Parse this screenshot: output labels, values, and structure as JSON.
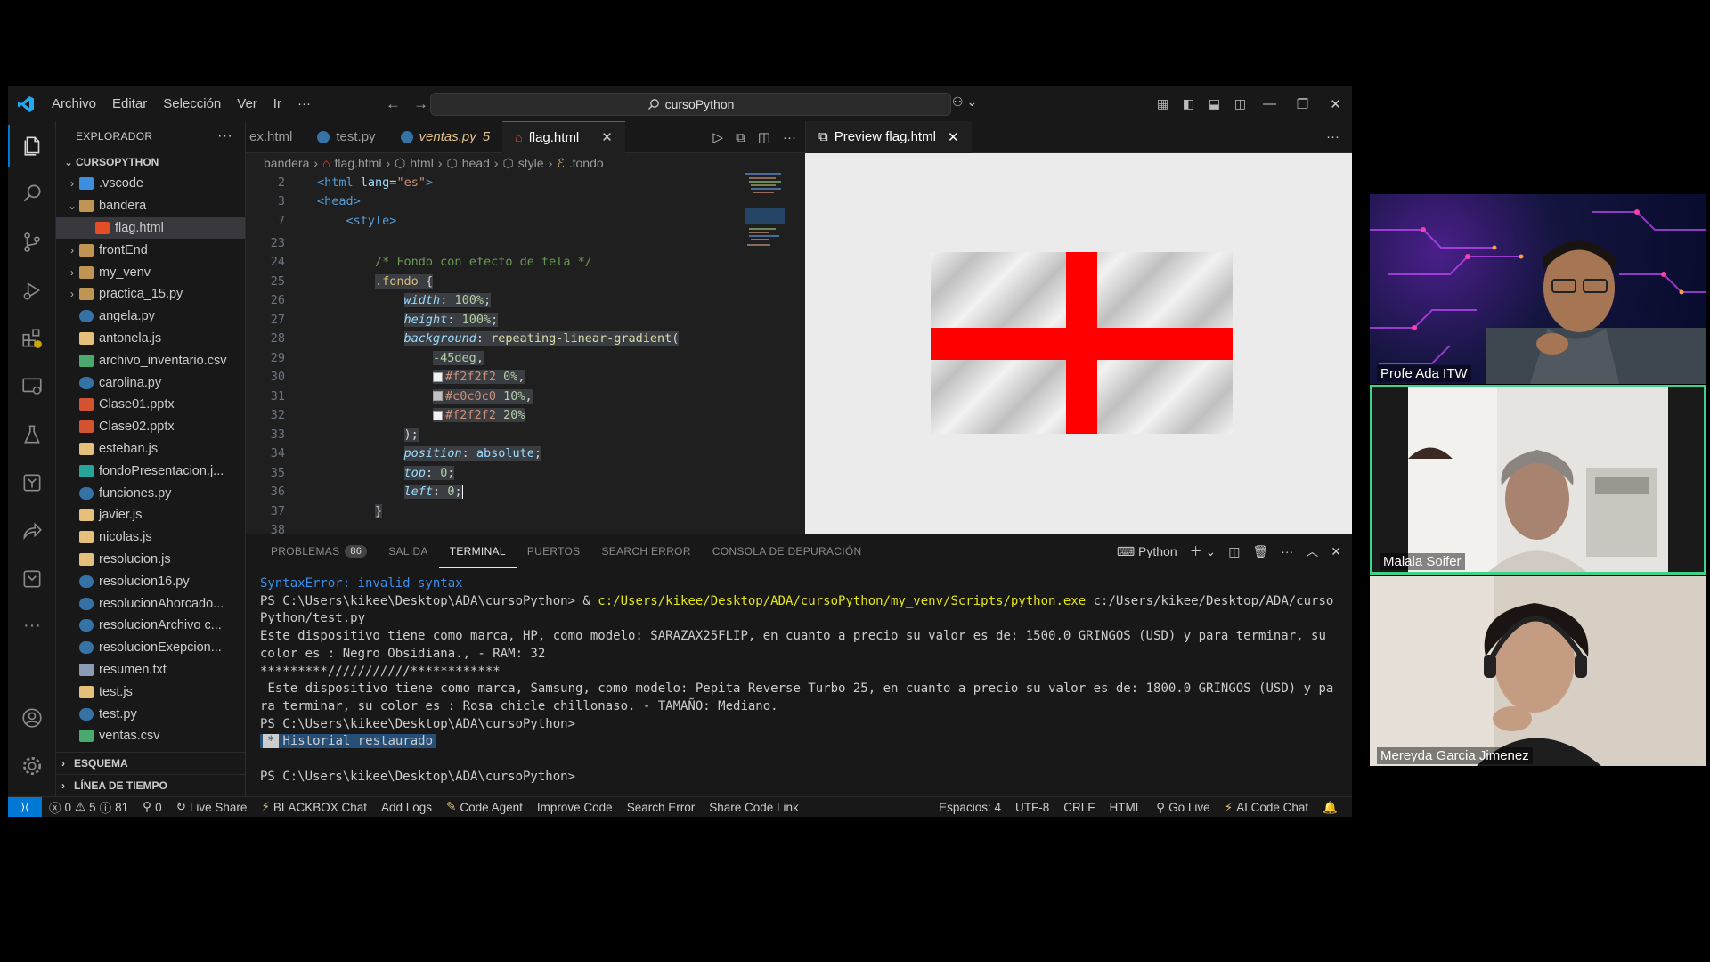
{
  "titlebar": {
    "menus": [
      "Archivo",
      "Editar",
      "Selección",
      "Ver",
      "Ir",
      "···"
    ],
    "search_text": "cursoPython",
    "colors": {
      "accent": "#0078d4",
      "window_bg": "#1f1f1f"
    }
  },
  "sidebar": {
    "header": "EXPLORADOR",
    "root": "CURSOPYTHON",
    "items": [
      {
        "label": ".vscode",
        "kind": "folder",
        "icon": "vscode-folder-icon",
        "chev": "›",
        "indent": 1
      },
      {
        "label": "bandera",
        "kind": "folder",
        "icon": "folder-open-icon",
        "chev": "⌄",
        "indent": 1
      },
      {
        "label": "flag.html",
        "kind": "html",
        "icon": "html-file-icon",
        "chev": "",
        "indent": 2,
        "selected": true
      },
      {
        "label": "frontEnd",
        "kind": "folder",
        "icon": "folder-icon",
        "chev": "›",
        "indent": 1
      },
      {
        "label": "my_venv",
        "kind": "folder",
        "icon": "folder-icon",
        "chev": "›",
        "indent": 1
      },
      {
        "label": "practica_15.py",
        "kind": "folder",
        "icon": "folder-icon",
        "chev": "›",
        "indent": 1
      },
      {
        "label": "angela.py",
        "kind": "py",
        "icon": "python-file-icon",
        "chev": "",
        "indent": 1
      },
      {
        "label": "antonela.js",
        "kind": "js",
        "icon": "js-file-icon",
        "chev": "",
        "indent": 1
      },
      {
        "label": "archivo_inventario.csv",
        "kind": "csv",
        "icon": "csv-file-icon",
        "chev": "",
        "indent": 1
      },
      {
        "label": "carolina.py",
        "kind": "py",
        "icon": "python-file-icon",
        "chev": "",
        "indent": 1
      },
      {
        "label": "Clase01.pptx",
        "kind": "pptx",
        "icon": "pptx-file-icon",
        "chev": "",
        "indent": 1
      },
      {
        "label": "Clase02.pptx",
        "kind": "pptx",
        "icon": "pptx-file-icon",
        "chev": "",
        "indent": 1
      },
      {
        "label": "esteban.js",
        "kind": "js",
        "icon": "js-file-icon",
        "chev": "",
        "indent": 1
      },
      {
        "label": "fondoPresentacion.j...",
        "kind": "img",
        "icon": "image-file-icon",
        "chev": "",
        "indent": 1
      },
      {
        "label": "funciones.py",
        "kind": "py",
        "icon": "python-file-icon",
        "chev": "",
        "indent": 1
      },
      {
        "label": "javier.js",
        "kind": "js",
        "icon": "js-file-icon",
        "chev": "",
        "indent": 1
      },
      {
        "label": "nicolas.js",
        "kind": "js",
        "icon": "js-file-icon",
        "chev": "",
        "indent": 1
      },
      {
        "label": "resolucion.js",
        "kind": "js",
        "icon": "js-file-icon",
        "chev": "",
        "indent": 1
      },
      {
        "label": "resolucion16.py",
        "kind": "py",
        "icon": "python-file-icon",
        "chev": "",
        "indent": 1
      },
      {
        "label": "resolucionAhorcado...",
        "kind": "py",
        "icon": "python-file-icon",
        "chev": "",
        "indent": 1
      },
      {
        "label": "resolucionArchivo c...",
        "kind": "py",
        "icon": "python-file-icon",
        "chev": "",
        "indent": 1
      },
      {
        "label": "resolucionExepcion...",
        "kind": "py",
        "icon": "python-file-icon",
        "chev": "",
        "indent": 1
      },
      {
        "label": "resumen.txt",
        "kind": "txt",
        "icon": "text-file-icon",
        "chev": "",
        "indent": 1
      },
      {
        "label": "test.js",
        "kind": "js",
        "icon": "js-file-icon",
        "chev": "",
        "indent": 1
      },
      {
        "label": "test.py",
        "kind": "py",
        "icon": "python-file-icon",
        "chev": "",
        "indent": 1
      },
      {
        "label": "ventas.csv",
        "kind": "csv",
        "icon": "csv-file-icon",
        "chev": "",
        "indent": 1
      }
    ],
    "sections": [
      "ESQUEMA",
      "LÍNEA DE TIEMPO"
    ]
  },
  "tabs": [
    {
      "label": "ex.html",
      "active": false
    },
    {
      "label": "test.py",
      "active": false
    },
    {
      "label": "ventas.py",
      "badge": "5",
      "active": false,
      "italic": true
    },
    {
      "label": "flag.html",
      "active": true
    }
  ],
  "breadcrumb": [
    "bandera",
    "flag.html",
    "html",
    "head",
    "style",
    ".fondo"
  ],
  "editor": {
    "line_numbers": [
      "2",
      "3",
      "7",
      "23",
      "24",
      "25",
      "26",
      "27",
      "28",
      "29",
      "30",
      "31",
      "32",
      "33",
      "34",
      "35",
      "36",
      "37",
      "38"
    ]
  },
  "preview": {
    "tab_label": "Preview flag.html",
    "flag_colors": {
      "cross": "#ff0000",
      "fabric_light": "#f2f2f2",
      "fabric_dark": "#c0c0c0"
    }
  },
  "panel": {
    "tabs": [
      {
        "label": "PROBLEMAS",
        "count": "86",
        "active": false
      },
      {
        "label": "SALIDA",
        "active": false
      },
      {
        "label": "TERMINAL",
        "active": true
      },
      {
        "label": "PUERTOS",
        "active": false
      },
      {
        "label": "SEARCH ERROR",
        "active": false
      },
      {
        "label": "CONSOLA DE DEPURACIÓN",
        "active": false
      }
    ],
    "terminal_profile": "Python",
    "terminal": {
      "error": "SyntaxError: invalid syntax",
      "prompt1": "PS C:\\Users\\kikee\\Desktop\\ADA\\cursoPython> & ",
      "exe": "c:/Users/kikee/Desktop/ADA/cursoPython/my_venv/Scripts/python.exe",
      "script": " c:/Users/kikee/Desktop/ADA/cursoPython/test.py",
      "out1": "Este dispositivo tiene como marca, HP, como modelo: SARAZAX25FLIP, en cuanto a precio su valor es de: 1500.0 GRINGOS (USD) y para terminar, su color es : Negro Obsidiana., - RAM: 32",
      "out2": "*********///////////************",
      "out3": " Este dispositivo tiene como marca, Samsung, como modelo: Pepita Reverse Turbo 25, en cuanto a precio su valor es de: 1800.0 GRINGOS (USD) y para terminar, su color es : Rosa chicle chillonaso. - TAMAÑO: Mediano.",
      "prompt2": "PS C:\\Users\\kikee\\Desktop\\ADA\\cursoPython>",
      "restored_star": "*",
      "restored": "Historial restaurado",
      "prompt3": "PS C:\\Users\\kikee\\Desktop\\ADA\\cursoPython>"
    }
  },
  "statusbar": {
    "errors": "0",
    "warnings": "5",
    "infos": "81",
    "ports": "0",
    "left_items": [
      "Live Share",
      "BLACKBOX Chat",
      "Add Logs",
      "Code Agent",
      "Improve Code",
      "Search Error",
      "Share Code Link"
    ],
    "right_items": [
      "Espacios: 4",
      "UTF-8",
      "CRLF",
      "HTML",
      "Go Live",
      "AI Code Chat"
    ]
  },
  "participants": [
    {
      "name": "Profe Ada ITW"
    },
    {
      "name": "Malala Soifer"
    },
    {
      "name": "Mereyda Garcia Jimenez"
    }
  ]
}
